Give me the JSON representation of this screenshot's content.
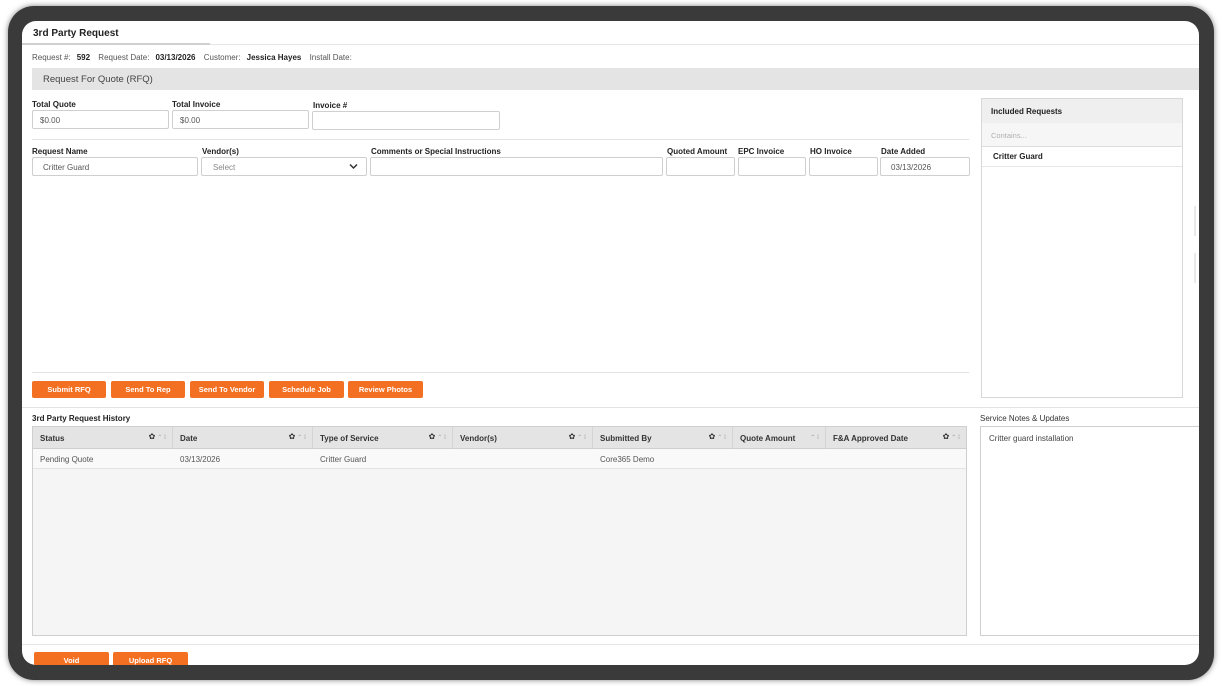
{
  "window": {
    "title": "3rd Party Request"
  },
  "meta": {
    "request_no_label": "Request #:",
    "request_no": "592",
    "request_date_label": "Request Date:",
    "request_date": "03/13/2026",
    "customer_label": "Customer:",
    "customer": "Jessica Hayes",
    "install_date_label": "Install Date:"
  },
  "rfq": {
    "section_title": "Request For Quote (RFQ)",
    "total_quote_label": "Total Quote",
    "total_quote": "$0.00",
    "total_invoice_label": "Total Invoice",
    "total_invoice": "$0.00",
    "invoice_no_label": "Invoice #",
    "invoice_no": "",
    "headers": {
      "request_name": "Request Name",
      "vendors": "Vendor(s)",
      "comments": "Comments or Special Instructions",
      "quoted_amount": "Quoted Amount",
      "epc_invoice": "EPC Invoice",
      "ho_invoice": "HO Invoice",
      "date_added": "Date Added"
    },
    "row": {
      "request_name": "Critter Guard",
      "vendor_placeholder": "Select",
      "comments": "",
      "quoted_amount": "",
      "epc_invoice": "",
      "ho_invoice": "",
      "date_added": "03/13/2026"
    },
    "buttons": {
      "submit": "Submit RFQ",
      "send_rep": "Send To Rep",
      "send_vendor": "Send To Vendor",
      "schedule": "Schedule Job",
      "review_photos": "Review Photos"
    }
  },
  "included": {
    "title": "Included Requests",
    "filter_placeholder": "Contains...",
    "items": [
      "Critter Guard"
    ]
  },
  "history": {
    "title": "3rd Party Request History",
    "columns": [
      "Status",
      "Date",
      "Type of Service",
      "Vendor(s)",
      "Submitted By",
      "Quote Amount",
      "F&A Approved Date"
    ],
    "rows": [
      {
        "status": "Pending Quote",
        "date": "03/13/2026",
        "type": "Critter Guard",
        "vendor": "",
        "submitted_by": "Core365 Demo",
        "quote_amount": "",
        "fa_date": ""
      }
    ]
  },
  "notes": {
    "title": "Service Notes & Updates",
    "text": "Critter guard installation"
  },
  "footer": {
    "void": "Void",
    "upload": "Upload RFQ"
  },
  "colors": {
    "accent": "#f36f21",
    "header_gray": "#e4e4e4"
  }
}
